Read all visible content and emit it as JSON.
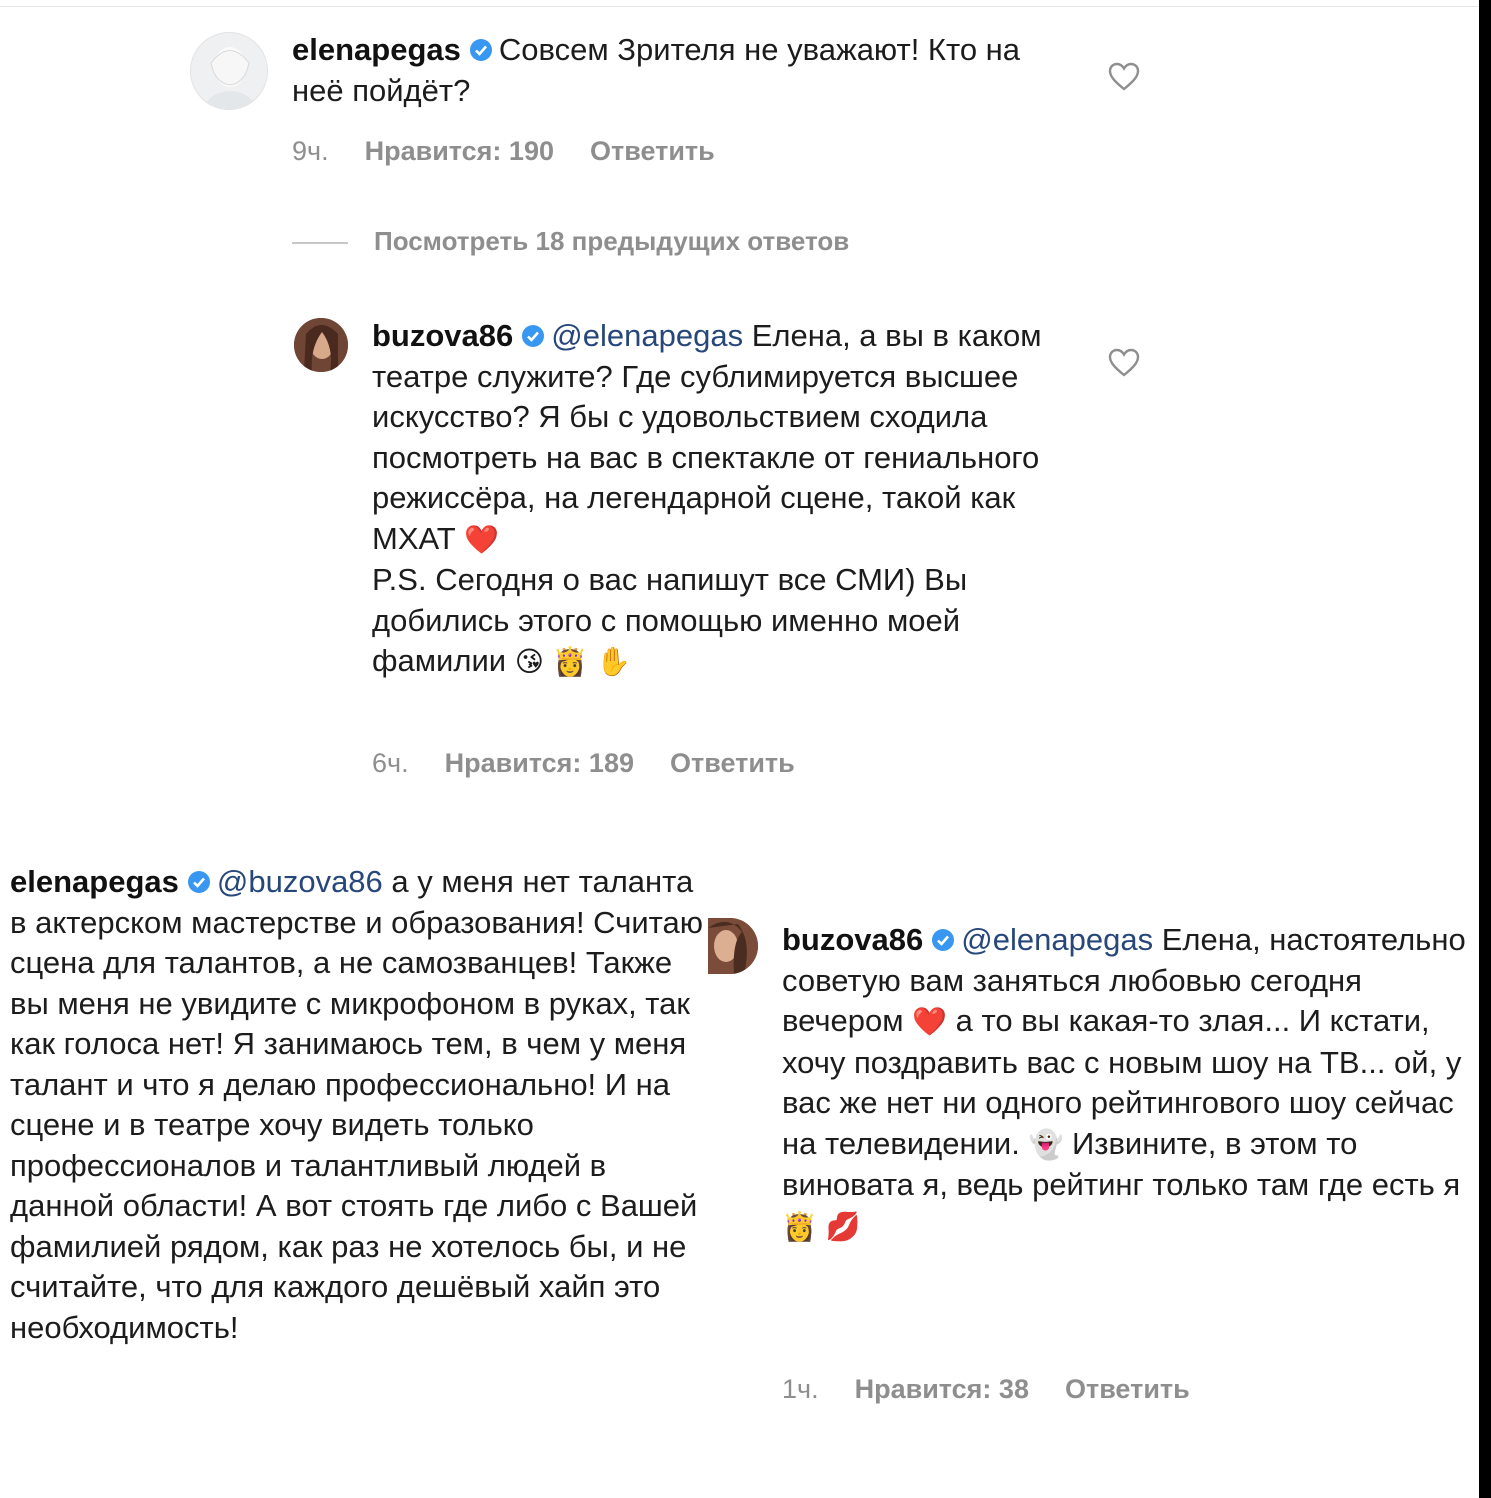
{
  "comments": [
    {
      "username": "elenapegas",
      "text": "Совсем Зрителя не уважают! Кто на неё пойдёт?",
      "time": "9ч.",
      "likes": "Нравится: 190",
      "reply": "Ответить",
      "heart_icon": "heart-outline-icon"
    },
    {
      "username": "buzova86",
      "mention": "@elenapegas",
      "text": "Елена, а вы в каком театре служите? Где сублимируется высшее искусство? Я бы с удовольствием сходила посмотреть на вас в спектакле от гениального режиссёра, на легендарной сцене, такой как МХАТ",
      "text2": "P.S. Сегодня о вас напишут все СМИ) Вы добились этого с помощью именно моей фамилии",
      "emojis": [
        "❤️",
        "😘",
        "👸",
        "✋"
      ],
      "time": "6ч.",
      "likes": "Нравится: 189",
      "reply": "Ответить",
      "heart_icon": "heart-outline-icon"
    },
    {
      "username": "elenapegas",
      "mention": "@buzova86",
      "text": "а у меня нет таланта в актерском мастерстве и образования! Считаю сцена для талантов, а не самозванцев! Также вы меня не увидите с микрофоном в руках, так как голоса нет! Я занимаюсь тем, в чем у меня талант и что я делаю профессионально! И на сцене и в театре хочу видеть только профессионалов и талантливый людей в данной области! А вот стоять где либо с Вашей фамилией рядом, как раз не хотелось бы, и не считайте, что для каждого дешёвый хайп это необходимость!"
    },
    {
      "username": "buzova86",
      "mention": "@elenapegas",
      "text": "Елена, настоятельно советую вам заняться любовью сегодня вечером",
      "text2": "а то вы какая-то злая... И кстати, хочу поздравить вас с новым шоу на ТВ... ой,  у вас же нет ни одного рейтингового шоу сейчас на телевидении.",
      "text3": "Извините, в этом то виновата я, ведь рейтинг только там где есть я",
      "emojis": [
        "❤️",
        "👻",
        "👸",
        "💋"
      ],
      "time": "1ч.",
      "likes": "Нравится: 38",
      "reply": "Ответить"
    }
  ],
  "view_replies": "Посмотреть 18 предыдущих ответов",
  "colors": {
    "verified": "#3897f0",
    "mention": "#27477b",
    "meta": "#8e8e8e",
    "heart": "#e0303e"
  }
}
